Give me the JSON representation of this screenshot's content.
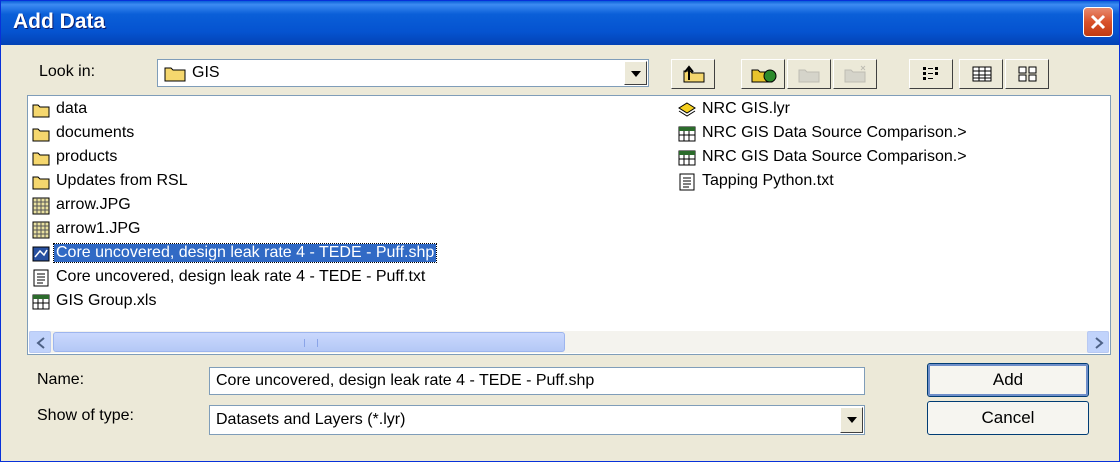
{
  "window": {
    "title": "Add Data"
  },
  "toolbar": {
    "look_in_label": "Look in:",
    "look_in_value": "GIS"
  },
  "files": [
    {
      "name": "data",
      "icon": "folder-icon"
    },
    {
      "name": "documents",
      "icon": "folder-icon"
    },
    {
      "name": "products",
      "icon": "folder-icon"
    },
    {
      "name": "Updates from RSL",
      "icon": "folder-icon"
    },
    {
      "name": "arrow.JPG",
      "icon": "raster-icon"
    },
    {
      "name": "arrow1.JPG",
      "icon": "raster-icon"
    },
    {
      "name": "Core uncovered, design leak rate 4 - TEDE - Puff.shp",
      "icon": "shapefile-icon",
      "selected": true
    },
    {
      "name": "Core uncovered, design leak rate 4 - TEDE - Puff.txt",
      "icon": "text-file-icon"
    },
    {
      "name": "GIS Group.xls",
      "icon": "table-icon"
    },
    {
      "name": "NRC GIS.lyr",
      "icon": "layer-icon"
    },
    {
      "name": "NRC GIS Data Source Comparison.>",
      "icon": "table-icon"
    },
    {
      "name": "NRC GIS Data Source Comparison.>",
      "icon": "table-icon"
    },
    {
      "name": "Tapping Python.txt",
      "icon": "text-file-icon"
    }
  ],
  "form": {
    "name_label": "Name:",
    "name_value": "Core uncovered, design leak rate 4 - TEDE - Puff.shp",
    "type_label": "Show of type:",
    "type_value": "Datasets and Layers (*.lyr)",
    "add_label": "Add",
    "cancel_label": "Cancel"
  }
}
